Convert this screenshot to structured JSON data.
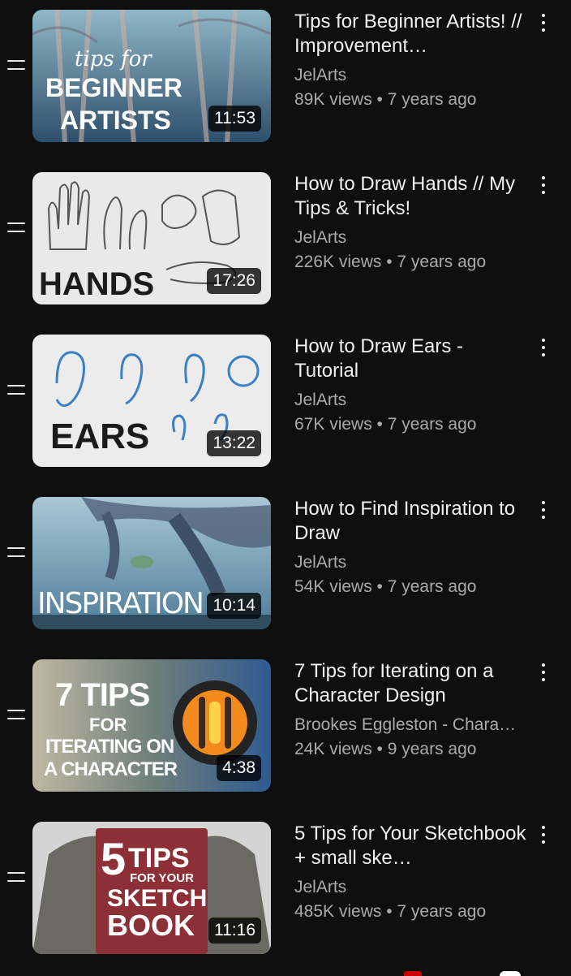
{
  "videos": [
    {
      "title": "Tips for Beginner Artists! // Improvement…",
      "channel": "JelArts",
      "stats": "89K views • 7 years ago",
      "duration": "11:53",
      "thumb_lines": [
        "tips for",
        "BEGINNER",
        "ARTISTS"
      ]
    },
    {
      "title": "How to Draw Hands // My Tips & Tricks!",
      "channel": "JelArts",
      "stats": "226K views • 7 years ago",
      "duration": "17:26",
      "thumb_lines": [
        "HANDS"
      ]
    },
    {
      "title": "How to Draw Ears - Tutorial",
      "channel": "JelArts",
      "stats": "67K views • 7 years ago",
      "duration": "13:22",
      "thumb_lines": [
        "EARS"
      ]
    },
    {
      "title": "How to Find Inspiration to Draw",
      "channel": "JelArts",
      "stats": "54K views • 7 years ago",
      "duration": "10:14",
      "thumb_lines": [
        "INSPIRATION"
      ]
    },
    {
      "title": "7 Tips for Iterating on a Character Design",
      "channel": "Brookes Eggleston - Chara…",
      "stats": "24K views • 9 years ago",
      "duration": "4:38",
      "thumb_lines": [
        "7 TIPS",
        "FOR",
        "ITERATING ON",
        "A CHARACTER"
      ]
    },
    {
      "title": "5 Tips for Your Sketchbook + small ske…",
      "channel": "JelArts",
      "stats": "485K views • 7 years ago",
      "duration": "11:16",
      "thumb_lines": [
        "5",
        "TIPS",
        "FOR YOUR",
        "SKETCH",
        "BOOK"
      ]
    }
  ],
  "icons": {
    "drag": "drag-handle-icon",
    "more": "more-vert-icon"
  },
  "colors": {
    "background": "#0f0f0f",
    "text_primary": "#f1f1f1",
    "text_secondary": "#aaaaaa"
  }
}
